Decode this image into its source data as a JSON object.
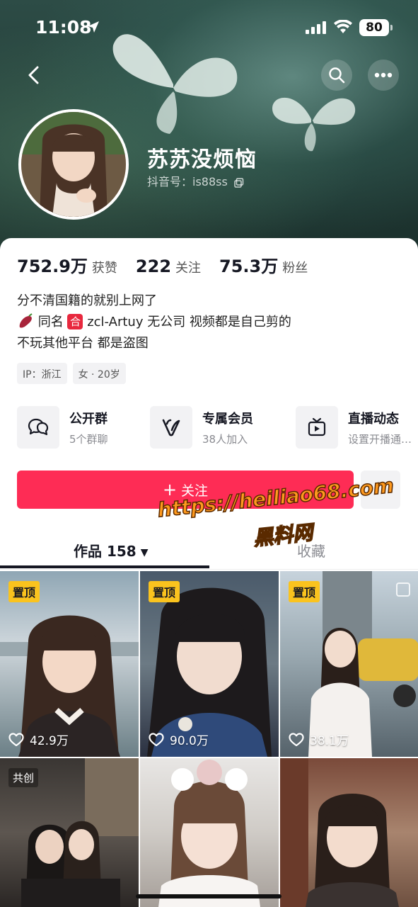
{
  "status_bar": {
    "time": "11:08",
    "battery": "80"
  },
  "profile": {
    "nickname": "苏苏没烦恼",
    "douyin_id": "抖音号：is88ss"
  },
  "stats": [
    {
      "value": "752.9万",
      "label": "获赞"
    },
    {
      "value": "222",
      "label": "关注"
    },
    {
      "value": "75.3万",
      "label": "粉丝"
    }
  ],
  "bio": {
    "line1": "分不清国籍的就别上网了",
    "line2_a": "同名",
    "line2_badge": "合",
    "line2_b": "zcl-Artuy 无公司 视频都是自己剪的",
    "line3": "不玩其他平台 都是盗图"
  },
  "tags": [
    "IP：浙江",
    "女 · 20岁"
  ],
  "features": [
    {
      "title": "公开群",
      "subtitle": "5个群聊",
      "icon": "group-chat-icon"
    },
    {
      "title": "专属会员",
      "subtitle": "38人加入",
      "icon": "vip-icon"
    },
    {
      "title": "直播动态",
      "subtitle": "设置开播通…",
      "icon": "live-tv-icon"
    }
  ],
  "follow_button": {
    "label": "关注"
  },
  "watermark": {
    "url": "https://heiliao68.com",
    "name": "黑料网"
  },
  "tabs": {
    "works": "作品 158",
    "favorites": "收藏"
  },
  "videos": [
    {
      "badge": "置顶",
      "likes": "42.9万"
    },
    {
      "badge": "置顶",
      "likes": "90.0万"
    },
    {
      "badge": "置顶",
      "likes": "38.1万"
    },
    {
      "badge": "共创",
      "likes": ""
    },
    {
      "badge": "",
      "likes": ""
    },
    {
      "badge": "",
      "likes": ""
    }
  ],
  "colors": {
    "accent": "#fe2c55",
    "pin": "#fac31e"
  }
}
